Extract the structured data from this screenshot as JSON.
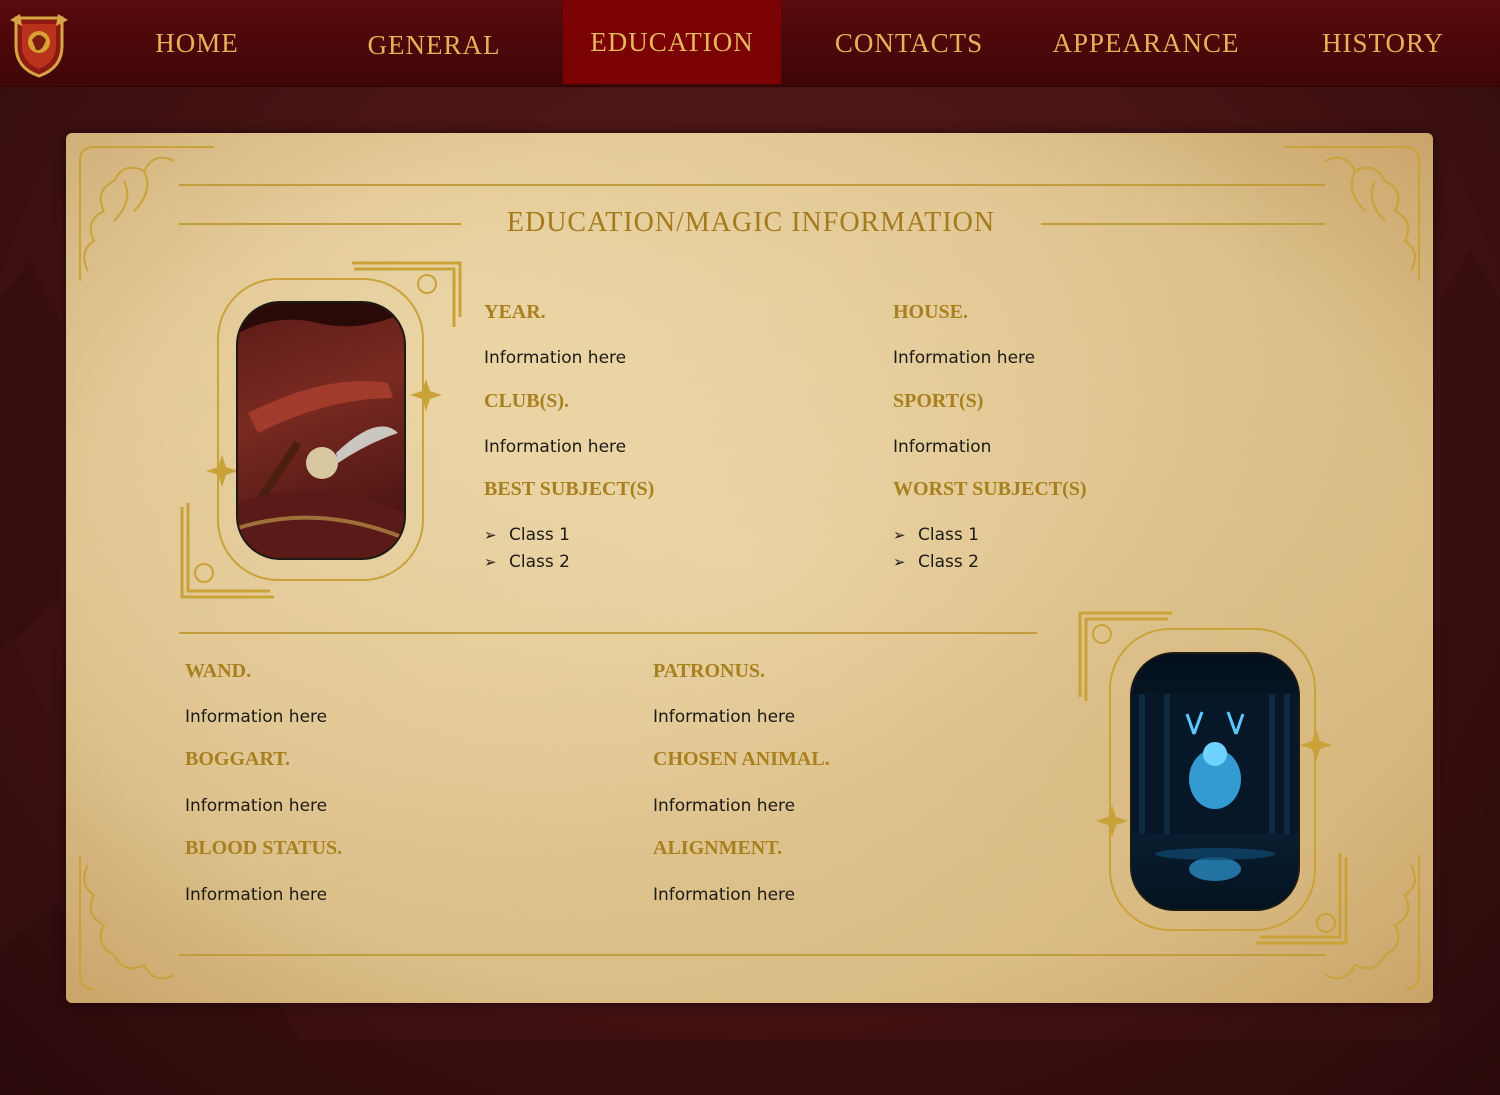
{
  "nav": {
    "items": [
      {
        "label": "HOME"
      },
      {
        "label": "GENERAL"
      },
      {
        "label": "EDUCATION"
      },
      {
        "label": "CONTACTS"
      },
      {
        "label": "APPEARANCE"
      },
      {
        "label": "HISTORY"
      }
    ],
    "active": "EDUCATION"
  },
  "card": {
    "title": "EDUCATION/MAGIC INFORMATION",
    "year": {
      "label": "YEAR.",
      "value": "Information here"
    },
    "house": {
      "label": "HOUSE.",
      "value": "Information here"
    },
    "clubs": {
      "label": "CLUB(S).",
      "value": "Information here"
    },
    "sports": {
      "label": "SPORT(S)",
      "value": "Information"
    },
    "best_subjects": {
      "label": "BEST SUBJECT(S)",
      "items": [
        "Class 1",
        "Class 2"
      ]
    },
    "worst_subjects": {
      "label": "WORST SUBJECT(S)",
      "items": [
        "Class 1",
        "Class 2"
      ]
    },
    "wand": {
      "label": "WAND.",
      "value": "Information here"
    },
    "boggart": {
      "label": "BOGGART.",
      "value": "Information here"
    },
    "blood_status": {
      "label": "BLOOD STATUS.",
      "value": "Information here"
    },
    "patronus": {
      "label": "PATRONUS.",
      "value": "Information here"
    },
    "chosen_animal": {
      "label": "CHOSEN ANIMAL.",
      "value": "Information here"
    },
    "alignment": {
      "label": "ALIGNMENT.",
      "value": "Information here"
    },
    "list_bullet": "➢"
  },
  "colors": {
    "nav_bg": "#4a0708",
    "nav_active": "#7a0203",
    "nav_text": "#e3b35a",
    "label_gold": "#a8801f",
    "page_bg": "#461314"
  },
  "icons": {
    "crest": "house-crest-icon",
    "photo_left": "quidditch-broom-photo",
    "photo_right": "stag-patronus-photo"
  }
}
